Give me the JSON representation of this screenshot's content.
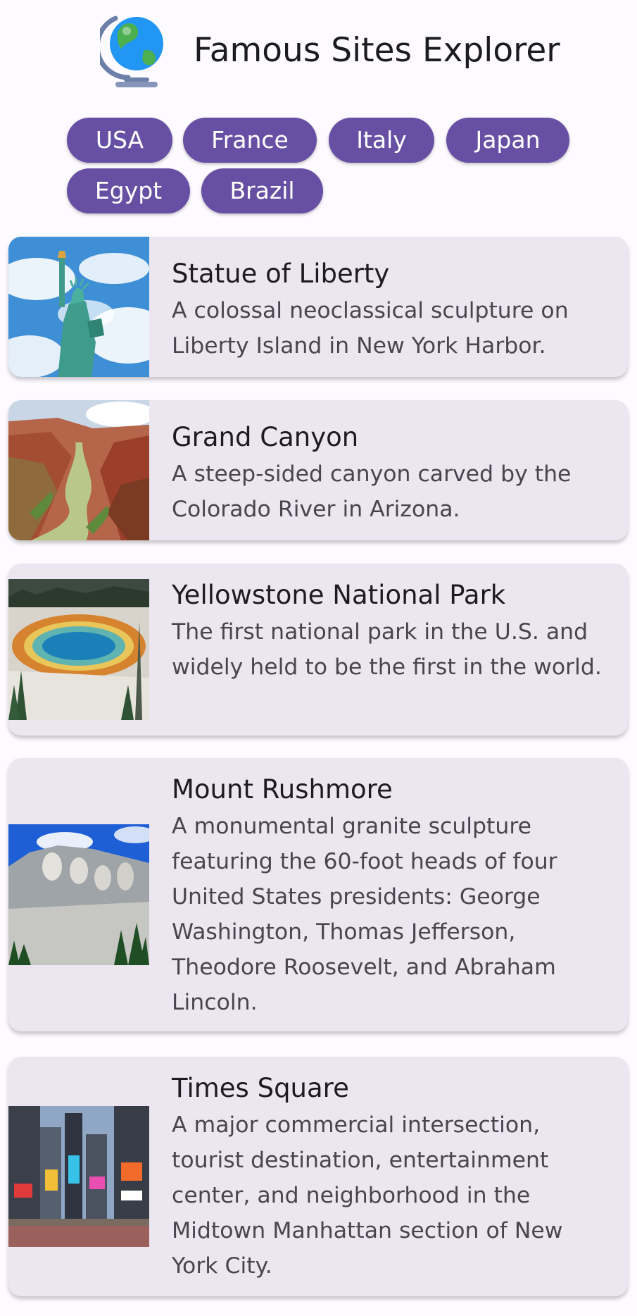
{
  "app": {
    "title": "Famous Sites Explorer",
    "logo_icon": "globe-icon"
  },
  "countries": [
    "USA",
    "France",
    "Italy",
    "Japan",
    "Egypt",
    "Brazil"
  ],
  "selected_country": "USA",
  "colors": {
    "chip_background": "#6750a4",
    "chip_text": "#ffffff",
    "card_background": "#ece6f0",
    "page_background": "#fdfbff",
    "title_text": "#1c1b1f",
    "description_text": "#49454f"
  },
  "sites": [
    {
      "name": "Statue of Liberty",
      "description": "A colossal neoclassical sculpture on Liberty Island in New York Harbor.",
      "image": "statue-of-liberty-photo"
    },
    {
      "name": "Grand Canyon",
      "description": "A steep-sided canyon carved by the Colorado River in Arizona.",
      "image": "grand-canyon-photo"
    },
    {
      "name": "Yellowstone National Park",
      "description": "The first national park in the U.S. and widely held to be the first in the world.",
      "image": "yellowstone-photo"
    },
    {
      "name": "Mount Rushmore",
      "description": "A monumental granite sculpture featuring the 60-foot heads of four United States presidents: George Washington, Thomas Jefferson, Theodore Roosevelt, and Abraham Lincoln.",
      "image": "mount-rushmore-photo"
    },
    {
      "name": "Times Square",
      "description": "A major commercial intersection, tourist destination, entertainment center, and neighborhood in the Midtown Manhattan section of New York City.",
      "image": "times-square-photo"
    }
  ]
}
